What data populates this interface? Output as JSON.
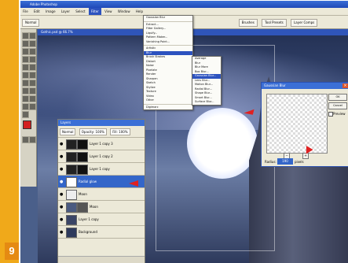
{
  "step": {
    "number": "9"
  },
  "app": {
    "title": "Adobe Photoshop"
  },
  "menubar": [
    {
      "label": "File"
    },
    {
      "label": "Edit"
    },
    {
      "label": "Image"
    },
    {
      "label": "Layer"
    },
    {
      "label": "Select"
    },
    {
      "label": "Filter"
    },
    {
      "label": "View"
    },
    {
      "label": "Window"
    },
    {
      "label": "Help"
    }
  ],
  "options": {
    "mode": "Normal",
    "brushes": "Brushes",
    "tool_presets": "Tool Presets",
    "layer_comps": "Layer Comps"
  },
  "document": {
    "title": "Gothic.psd @ 66.7%"
  },
  "filter_menu": {
    "items": [
      {
        "label": "Gaussian Blur",
        "shortcut": "Ctrl+F"
      },
      {
        "label": "Extract...",
        "shortcut": "Alt+Ctrl+X"
      },
      {
        "label": "Filter Gallery..."
      },
      {
        "label": "Liquify...",
        "shortcut": "Shift+Ctrl+X"
      },
      {
        "label": "Pattern Maker...",
        "shortcut": "Alt+Shift+Ctrl+X"
      },
      {
        "label": "Vanishing Point...",
        "shortcut": "Alt+Ctrl+V"
      },
      {
        "label": "Artistic"
      },
      {
        "label": "Blur"
      },
      {
        "label": "Brush Strokes"
      },
      {
        "label": "Distort"
      },
      {
        "label": "Noise"
      },
      {
        "label": "Pixelate"
      },
      {
        "label": "Render"
      },
      {
        "label": "Sharpen"
      },
      {
        "label": "Sketch"
      },
      {
        "label": "Stylize"
      },
      {
        "label": "Texture"
      },
      {
        "label": "Video"
      },
      {
        "label": "Other"
      },
      {
        "label": "Digimarc"
      }
    ]
  },
  "blur_menu": {
    "items": [
      {
        "label": "Average"
      },
      {
        "label": "Blur"
      },
      {
        "label": "Blur More"
      },
      {
        "label": "Box Blur..."
      },
      {
        "label": "Gaussian Blur..."
      },
      {
        "label": "Lens Blur..."
      },
      {
        "label": "Motion Blur..."
      },
      {
        "label": "Radial Blur..."
      },
      {
        "label": "Shape Blur..."
      },
      {
        "label": "Smart Blur..."
      },
      {
        "label": "Surface Blur..."
      }
    ]
  },
  "layers_panel": {
    "title": "Layers",
    "blend_mode": "Normal",
    "opacity_label": "Opacity: 100%",
    "fill_label": "Fill: 100%",
    "layers": [
      {
        "name": "Layer 1 copy 3"
      },
      {
        "name": "Layer 1 copy 2"
      },
      {
        "name": "Layer 1 copy"
      },
      {
        "name": "Radial glow"
      },
      {
        "name": "Moon"
      },
      {
        "name": "Moon"
      },
      {
        "name": "Layer 1 copy"
      },
      {
        "name": "Background"
      }
    ]
  },
  "blur_dialog": {
    "title": "Gaussian Blur",
    "ok_label": "OK",
    "cancel_label": "Cancel",
    "preview_label": "Preview",
    "zoom_out": "−",
    "zoom_in": "+",
    "radius_label": "Radius:",
    "radius_value": "190",
    "radius_unit": "pixels"
  },
  "colors": {
    "accent": "#f0a91a",
    "step_badge": "#e58a12",
    "title_blue": "#3b6fd6",
    "arrow": "#e02020"
  }
}
